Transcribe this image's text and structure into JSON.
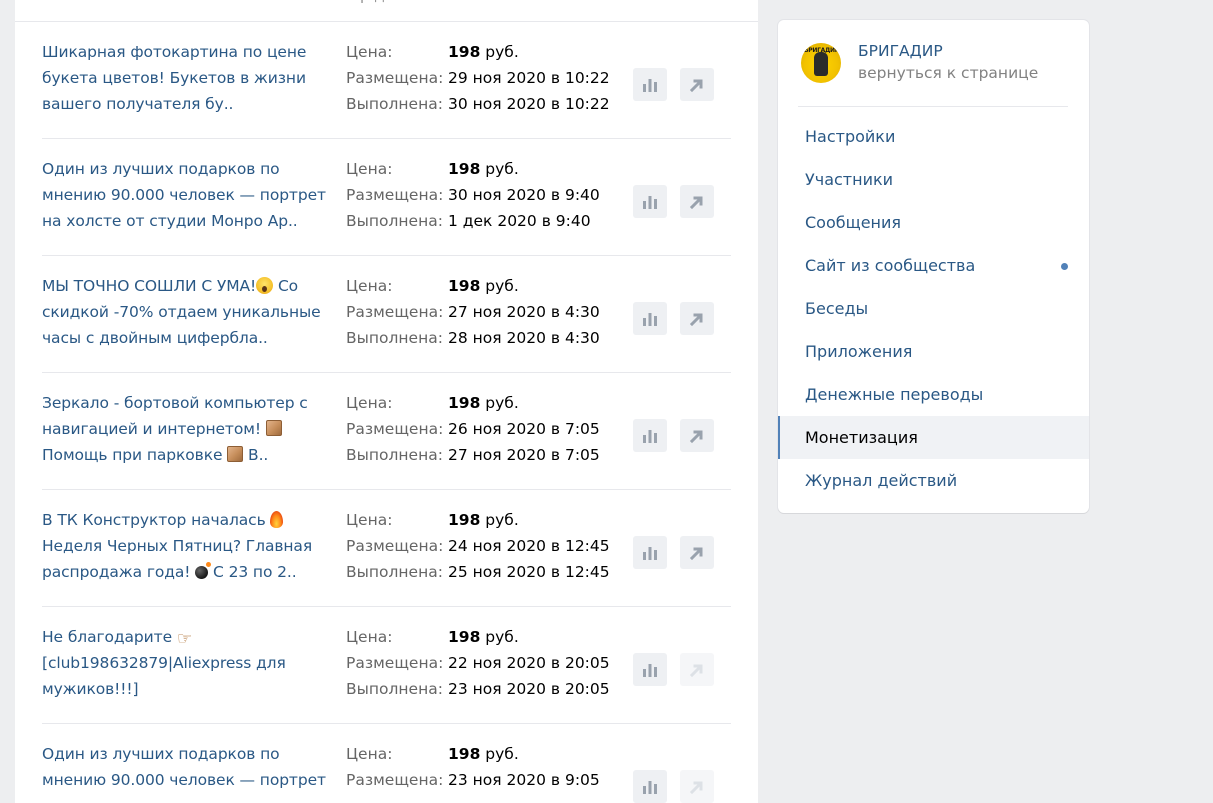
{
  "top_cut_text": "р                                        д",
  "labels": {
    "price": "Цена:",
    "posted": "Размещена:",
    "completed": "Выполнена:"
  },
  "currency": "руб.",
  "rows": [
    {
      "title": [
        "Шикарная фотокартина по цене",
        "букета цветов! Букетов в жизни",
        "вашего получателя бу.."
      ],
      "price": "198",
      "posted": "29 ноя 2020 в 10:22",
      "completed": "30 ноя 2020 в 10:22",
      "share_enabled": true
    },
    {
      "title": [
        "Один из лучших подарков по",
        "мнению 90.000 человек — портрет",
        "на холсте от студии Монро Ар.."
      ],
      "price": "198",
      "posted": "30 ноя 2020 в 9:40",
      "completed": "1 дек 2020 в 9:40",
      "share_enabled": true
    },
    {
      "title": [
        "МЫ ТОЧНО СОШЛИ С УМА!",
        " Со",
        "скидкой -70% отдаем уникальные",
        "часы с двойным цифербла.."
      ],
      "price": "198",
      "posted": "27 ноя 2020 в 4:30",
      "completed": "28 ноя 2020 в 4:30",
      "share_enabled": true
    },
    {
      "title": [
        "Зеркало - бортовой компьютер с",
        "навигацией и интернетом!",
        "Помощь при парковке",
        " В.."
      ],
      "price": "198",
      "posted": "26 ноя 2020 в 7:05",
      "completed": "27 ноя 2020 в 7:05",
      "share_enabled": true
    },
    {
      "title": [
        "В ТК Конструктор началась",
        "Неделя Черных Пятниц? Главная",
        "распродажа года!",
        " С 23 по 2.."
      ],
      "price": "198",
      "posted": "24 ноя 2020 в 12:45",
      "completed": "25 ноя 2020 в 12:45",
      "share_enabled": true
    },
    {
      "title": [
        "Не благодарите",
        "[club198632879|Aliexpress для",
        "мужиков!!!]"
      ],
      "price": "198",
      "posted": "22 ноя 2020 в 20:05",
      "completed": "23 ноя 2020 в 20:05",
      "share_enabled": false
    },
    {
      "title": [
        "Один из лучших подарков по",
        "мнению 90.000 человек — портрет"
      ],
      "price": "198",
      "posted": "23 ноя 2020 в 9:05",
      "completed": "",
      "share_enabled": false
    }
  ],
  "group": {
    "avatar_text": "БРИГАДИР",
    "name": "БРИГАДИР",
    "back_link": "вернуться к странице"
  },
  "menu": [
    {
      "label": "Настройки"
    },
    {
      "label": "Участники"
    },
    {
      "label": "Сообщения"
    },
    {
      "label": "Сайт из сообщества",
      "dot": true
    },
    {
      "label": "Беседы"
    },
    {
      "label": "Приложения"
    },
    {
      "label": "Денежные переводы"
    },
    {
      "label": "Монетизация",
      "active": true
    },
    {
      "label": "Журнал действий"
    }
  ],
  "colors": {
    "link": "#2a5885",
    "background": "#edeef0",
    "active_marker": "#5181b8",
    "label_gray": "#656565"
  },
  "icons": {
    "stats": "bar-chart-icon",
    "share": "arrow-up-right-icon"
  }
}
